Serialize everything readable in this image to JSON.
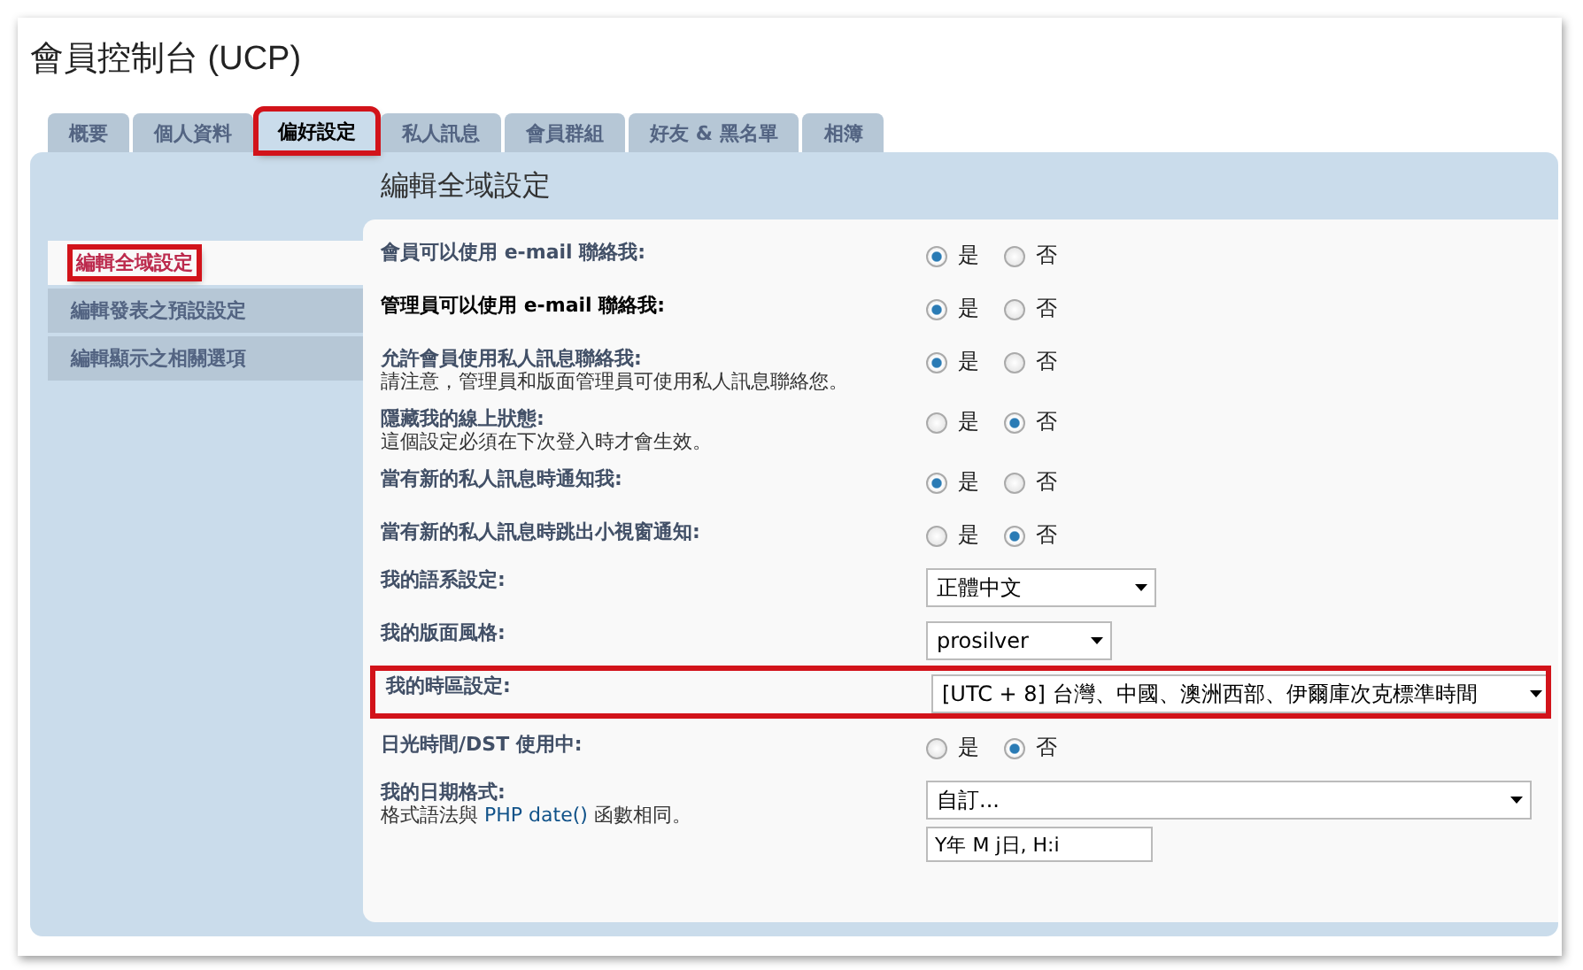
{
  "page": {
    "title": "會員控制台 (UCP)"
  },
  "tabs": [
    {
      "label": "概要",
      "selected": false,
      "highlighted": false
    },
    {
      "label": "個人資料",
      "selected": false,
      "highlighted": false
    },
    {
      "label": "偏好設定",
      "selected": true,
      "highlighted": true
    },
    {
      "label": "私人訊息",
      "selected": false,
      "highlighted": false
    },
    {
      "label": "會員群組",
      "selected": false,
      "highlighted": false
    },
    {
      "label": "好友 & 黑名單",
      "selected": false,
      "highlighted": false
    },
    {
      "label": "相簿",
      "selected": false,
      "highlighted": false
    }
  ],
  "sidebar": {
    "items": [
      {
        "label": "編輯全域設定",
        "selected": true,
        "highlighted": true
      },
      {
        "label": "編輯發表之預設設定",
        "selected": false,
        "highlighted": false
      },
      {
        "label": "編輯顯示之相關選項",
        "selected": false,
        "highlighted": false
      }
    ]
  },
  "content": {
    "heading": "編輯全域設定",
    "rows": [
      {
        "kind": "radio",
        "label": "會員可以使用 e-mail 聯絡我:",
        "hovered": false,
        "highlighted": false,
        "options": [
          {
            "label": "是",
            "selected": true
          },
          {
            "label": "否",
            "selected": false
          }
        ]
      },
      {
        "kind": "radio",
        "label": "管理員可以使用 e-mail 聯絡我:",
        "hovered": true,
        "highlighted": false,
        "options": [
          {
            "label": "是",
            "selected": true
          },
          {
            "label": "否",
            "selected": false
          }
        ]
      },
      {
        "kind": "radio",
        "label": "允許會員使用私人訊息聯絡我:",
        "explain": "請注意，管理員和版面管理員可使用私人訊息聯絡您。",
        "hovered": false,
        "highlighted": false,
        "options": [
          {
            "label": "是",
            "selected": true
          },
          {
            "label": "否",
            "selected": false
          }
        ]
      },
      {
        "kind": "radio",
        "label": "隱藏我的線上狀態:",
        "explain": "這個設定必須在下次登入時才會生效。",
        "hovered": false,
        "highlighted": false,
        "options": [
          {
            "label": "是",
            "selected": false
          },
          {
            "label": "否",
            "selected": true
          }
        ]
      },
      {
        "kind": "radio",
        "label": "當有新的私人訊息時通知我:",
        "hovered": false,
        "highlighted": false,
        "options": [
          {
            "label": "是",
            "selected": true
          },
          {
            "label": "否",
            "selected": false
          }
        ]
      },
      {
        "kind": "radio",
        "label": "當有新的私人訊息時跳出小視窗通知:",
        "hovered": false,
        "highlighted": false,
        "options": [
          {
            "label": "是",
            "selected": false
          },
          {
            "label": "否",
            "selected": true
          }
        ]
      },
      {
        "kind": "select",
        "label": "我的語系設定:",
        "hovered": false,
        "highlighted": false,
        "value": "正體中文"
      },
      {
        "kind": "select",
        "label": "我的版面風格:",
        "hovered": false,
        "highlighted": false,
        "value": "prosilver"
      },
      {
        "kind": "select",
        "label": "我的時區設定:",
        "hovered": false,
        "highlighted": true,
        "value": "[UTC + 8] 台灣、中國、澳洲西部、伊爾庫次克標準時間"
      },
      {
        "kind": "radio",
        "label": "日光時間/DST 使用中:",
        "hovered": false,
        "highlighted": false,
        "options": [
          {
            "label": "是",
            "selected": false
          },
          {
            "label": "否",
            "selected": true
          }
        ]
      },
      {
        "kind": "date",
        "label": "我的日期格式:",
        "explain_before": "格式語法與",
        "link": "PHP date()",
        "explain_after": "函數相同。",
        "hovered": false,
        "highlighted": false,
        "value": "自訂...",
        "input": "Y年 M j日, H:i"
      }
    ]
  }
}
